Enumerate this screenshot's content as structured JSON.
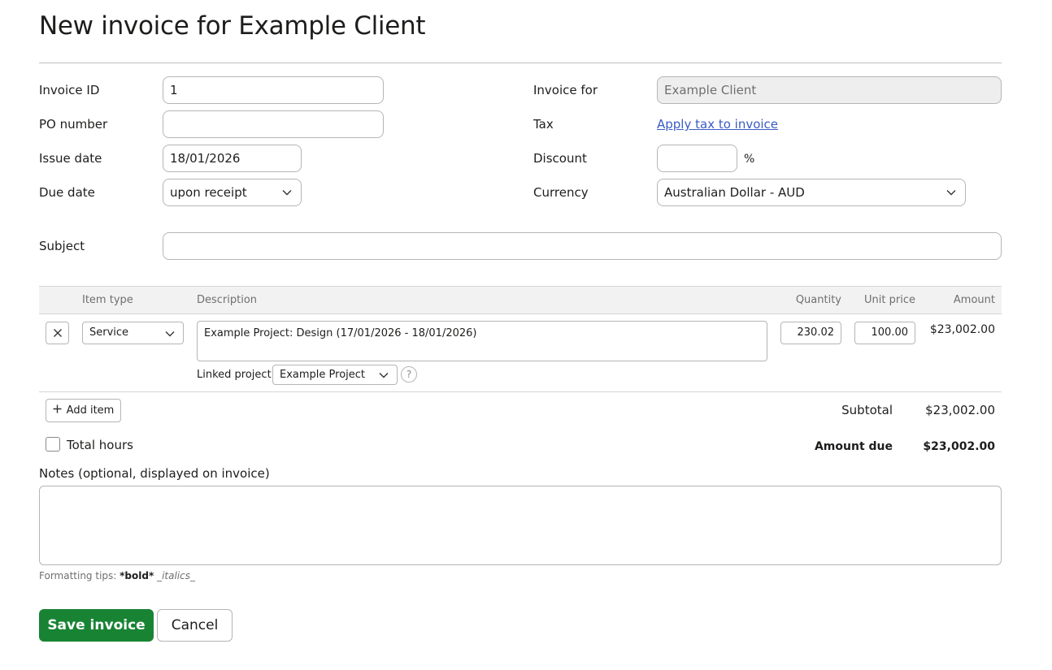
{
  "page": {
    "title": "New invoice for Example Client"
  },
  "form": {
    "invoice_id": {
      "label": "Invoice ID",
      "value": "1"
    },
    "po_number": {
      "label": "PO number",
      "value": ""
    },
    "issue_date": {
      "label": "Issue date",
      "value": "18/01/2026"
    },
    "due_date": {
      "label": "Due date",
      "value": "upon receipt"
    },
    "invoice_for": {
      "label": "Invoice for",
      "value": "Example Client"
    },
    "tax": {
      "label": "Tax",
      "link": "Apply tax to invoice"
    },
    "discount": {
      "label": "Discount",
      "value": "",
      "unit": "%"
    },
    "currency": {
      "label": "Currency",
      "value": "Australian Dollar - AUD"
    },
    "subject": {
      "label": "Subject",
      "value": ""
    }
  },
  "items_table": {
    "headers": {
      "item_type": "Item type",
      "description": "Description",
      "quantity": "Quantity",
      "unit_price": "Unit price",
      "amount": "Amount"
    },
    "rows": [
      {
        "item_type": "Service",
        "description": "Example Project: Design (17/01/2026 - 18/01/2026)",
        "quantity": "230.02",
        "unit_price": "100.00",
        "amount": "$23,002.00",
        "linked_project_label": "Linked project:",
        "linked_project": "Example Project"
      }
    ]
  },
  "add_item_label": "Add item",
  "total_hours_label": "Total hours",
  "totals": {
    "subtotal_label": "Subtotal",
    "subtotal": "$23,002.00",
    "amount_due_label": "Amount due",
    "amount_due": "$23,002.00"
  },
  "notes": {
    "label": "Notes (optional, displayed on invoice)",
    "value": "",
    "tips_prefix": "Formatting tips:",
    "tips_bold": "*bold*",
    "tips_italic": "_italics_"
  },
  "actions": {
    "save": "Save invoice",
    "cancel": "Cancel"
  },
  "colors": {
    "primary": "#188433",
    "link": "#3b5bc4"
  },
  "icons": {
    "remove": "close-icon",
    "dropdown": "chevron-down-icon",
    "add": "plus-icon",
    "help": "question-icon"
  }
}
